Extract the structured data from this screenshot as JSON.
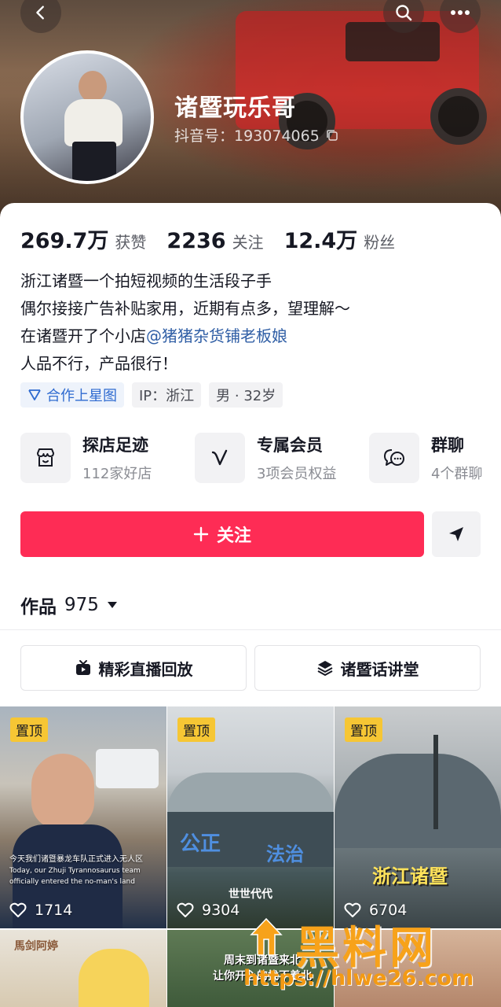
{
  "header": {
    "username": "诸暨玩乐哥",
    "douyin_id": "抖音号：193074065"
  },
  "stats": [
    {
      "value": "269.7万",
      "label": "获赞"
    },
    {
      "value": "2236",
      "label": "关注"
    },
    {
      "value": "12.4万",
      "label": "粉丝"
    }
  ],
  "bio": {
    "line1": "浙江诸暨一个拍短视频的生活段子手",
    "line2": "偶尔接接广告补贴家用，近期有点多，望理解～",
    "line3_prefix": "在诸暨开了个小店",
    "line3_mention": "@猪猪杂货铺老板娘",
    "line4": "人品不行，产品很行！"
  },
  "tags": {
    "star_map": "合作上星图",
    "ip": "IP：浙江",
    "gender_age": "男 · 32岁"
  },
  "services": [
    {
      "title": "探店足迹",
      "sub": "112家好店",
      "icon": "shop-icon"
    },
    {
      "title": "专属会员",
      "sub": "3项会员权益",
      "icon": "vip-icon"
    },
    {
      "title": "群聊",
      "sub": "4个群聊",
      "icon": "chat-icon"
    }
  ],
  "actions": {
    "follow_label": "关注"
  },
  "works": {
    "label": "作品",
    "count": "975"
  },
  "collections": [
    {
      "label": "精彩直播回放",
      "icon": "tv-icon"
    },
    {
      "label": "诸暨话讲堂",
      "icon": "layers-icon"
    }
  ],
  "videos": [
    {
      "pinned": "置顶",
      "likes": "1714",
      "caption_cn": "今天我们诸暨暴龙车队正式进入无人区",
      "caption_en": "Today, our Zhuji Tyrannosaurus team officially entered the no-man's land"
    },
    {
      "pinned": "置顶",
      "likes": "9304",
      "sign1": "公正",
      "sign2": "法治",
      "sign3": "世世代代"
    },
    {
      "pinned": "置顶",
      "likes": "6704",
      "overlay": "浙江诸暨"
    },
    {
      "sign": "馬剑阿婷"
    },
    {
      "overlay1": "周末到诸暨来北",
      "overlay2": "让你开心的找不着北"
    },
    {}
  ],
  "watermark": {
    "title": "黑料网",
    "url": "https://hlwe26.com"
  }
}
